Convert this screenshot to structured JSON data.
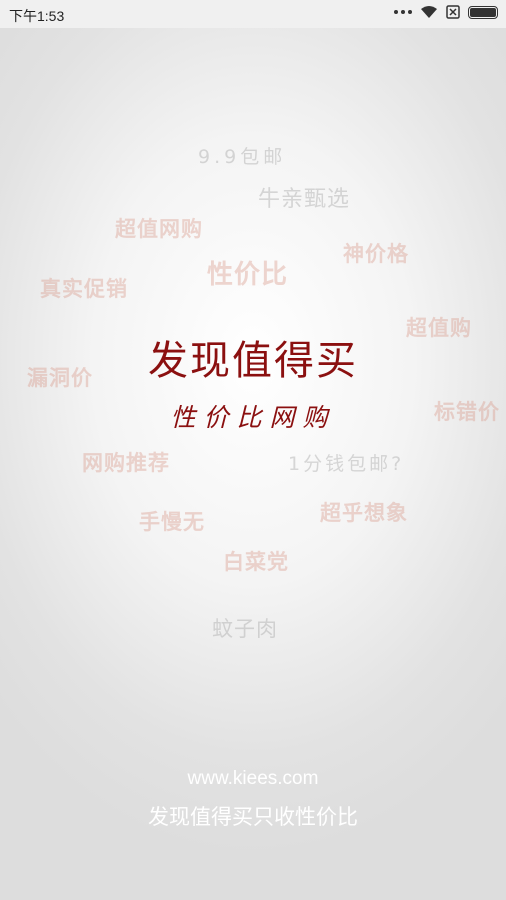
{
  "status_bar": {
    "time": "下午1:53",
    "icons": [
      "more-dots-icon",
      "wifi-icon",
      "sim-disabled-icon",
      "battery-icon"
    ]
  },
  "tags": [
    {
      "text": "9.9包邮",
      "style": "gray"
    },
    {
      "text": "牛亲甄选",
      "style": "gray"
    },
    {
      "text": "超值网购",
      "style": "pink"
    },
    {
      "text": "神价格",
      "style": "pink"
    },
    {
      "text": "真实促销",
      "style": "pink"
    },
    {
      "text": "性价比",
      "style": "pink"
    },
    {
      "text": "超值购",
      "style": "pink"
    },
    {
      "text": "漏洞价",
      "style": "pink"
    },
    {
      "text": "标错价",
      "style": "pink"
    },
    {
      "text": "网购推荐",
      "style": "pink"
    },
    {
      "text": "1分钱包邮?",
      "style": "gray"
    },
    {
      "text": "超乎想象",
      "style": "pink"
    },
    {
      "text": "手慢无",
      "style": "pink"
    },
    {
      "text": "白菜党",
      "style": "pink"
    },
    {
      "text": "蚊子肉",
      "style": "gray"
    }
  ],
  "brand": {
    "headline": "发现值得买",
    "subheadline": "性价比网购"
  },
  "footer": {
    "url": "www.kiees.com",
    "slogan": "发现值得买只收性价比"
  },
  "colors": {
    "brand_red": "#8b1010",
    "tag_pink": "#d79687",
    "footer_text": "#ffffff"
  }
}
